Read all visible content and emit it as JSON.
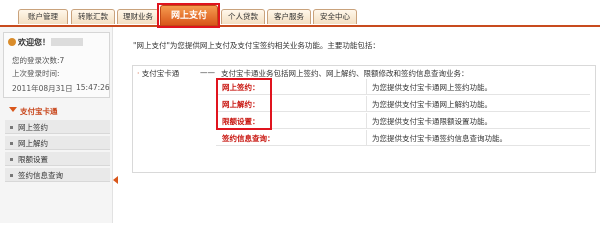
{
  "tabs": [
    {
      "label": "账户管理"
    },
    {
      "label": "转账汇款"
    },
    {
      "label": "理财业务"
    },
    {
      "label": "网上支付"
    },
    {
      "label": "个人贷款"
    },
    {
      "label": "客户服务"
    },
    {
      "label": "安全中心"
    }
  ],
  "sidebar": {
    "welcome": "欢迎您！",
    "login_count": "您的登录次数:7",
    "last_login_label": "上次登录时间:",
    "last_login_date": "2011年08月31日",
    "last_login_time": "15:47:26",
    "section_title": "支付宝卡通",
    "items": [
      {
        "label": "网上签约"
      },
      {
        "label": "网上解约"
      },
      {
        "label": "限额设置"
      },
      {
        "label": "签约信息查询"
      }
    ]
  },
  "main": {
    "intro": "\"网上支付\"为您提供网上支付及支付宝签约相关业务功能。主要功能包括：",
    "section_label": "支付宝卡通",
    "dash": "——",
    "section_desc": "支付宝卡通业务包括网上签约、网上解约、限额修改和签约信息查询业务：",
    "rows": [
      {
        "name": "网上签约：",
        "desc": "为您提供支付宝卡通网上签约功能。"
      },
      {
        "name": "网上解约：",
        "desc": "为您提供支付宝卡通网上解约功能。"
      },
      {
        "name": "限额设置：",
        "desc": "为您提供支付宝卡通限额设置功能。"
      },
      {
        "name": "签约信息查询：",
        "desc": "为您提供支付宝卡通签约信息查询功能。"
      }
    ]
  },
  "colors": {
    "accent": "#d9561a",
    "highlight": "#e0141e",
    "link": "#c8150f"
  }
}
